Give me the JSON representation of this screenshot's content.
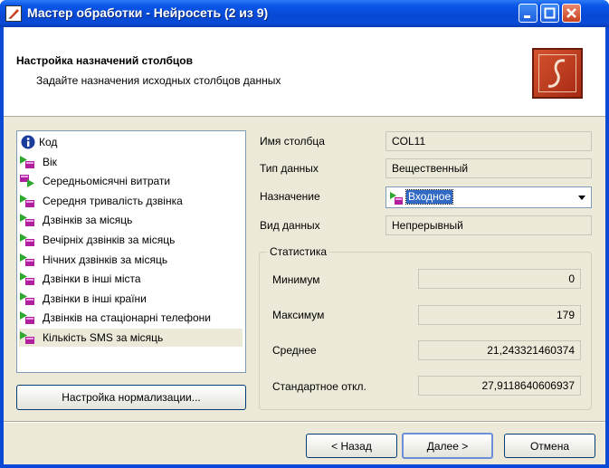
{
  "window": {
    "title": "Мастер обработки - Нейросеть (2 из 9)"
  },
  "header": {
    "title": "Настройка назначений столбцов",
    "subtitle": "Задайте назначения исходных столбцов данных"
  },
  "columns": [
    {
      "label": "Код",
      "icon": "info-icon"
    },
    {
      "label": "Вік",
      "icon": "input-column-icon"
    },
    {
      "label": "Середньомісячні витрати",
      "icon": "output-column-icon"
    },
    {
      "label": "Середня тривалість дзвінка",
      "icon": "input-column-icon"
    },
    {
      "label": "Дзвінків за місяць",
      "icon": "input-column-icon"
    },
    {
      "label": "Вечірніх дзвінків за місяць",
      "icon": "input-column-icon"
    },
    {
      "label": "Нічних дзвінків за місяць",
      "icon": "input-column-icon"
    },
    {
      "label": "Дзвінки в інші міста",
      "icon": "input-column-icon"
    },
    {
      "label": "Дзвінки в інші країни",
      "icon": "input-column-icon"
    },
    {
      "label": "Дзвінків на стаціонарні телефони",
      "icon": "input-column-icon"
    },
    {
      "label": "Кількість SMS за місяць",
      "icon": "input-column-icon",
      "selected": true
    }
  ],
  "normalization_button": "Настройка нормализации...",
  "properties": {
    "name_label": "Имя столбца",
    "name_value": "COL11",
    "type_label": "Тип данных",
    "type_value": "Вещественный",
    "purpose_label": "Назначение",
    "purpose_value": "Входное",
    "kind_label": "Вид данных",
    "kind_value": "Непрерывный"
  },
  "statistics": {
    "title": "Статистика",
    "min_label": "Минимум",
    "min_value": "0",
    "max_label": "Максимум",
    "max_value": "179",
    "mean_label": "Среднее",
    "mean_value": "21,243321460374",
    "std_label": "Стандартное откл.",
    "std_value": "27,9118640606937"
  },
  "footer": {
    "back_label": "< Назад",
    "next_label": "Далее >",
    "cancel_label": "Отмена"
  },
  "colors": {
    "titlebar": "#0a56e8",
    "selection": "#316ac5",
    "input_icon_green": "#2fa82f",
    "input_icon_magenta": "#b0209e"
  }
}
